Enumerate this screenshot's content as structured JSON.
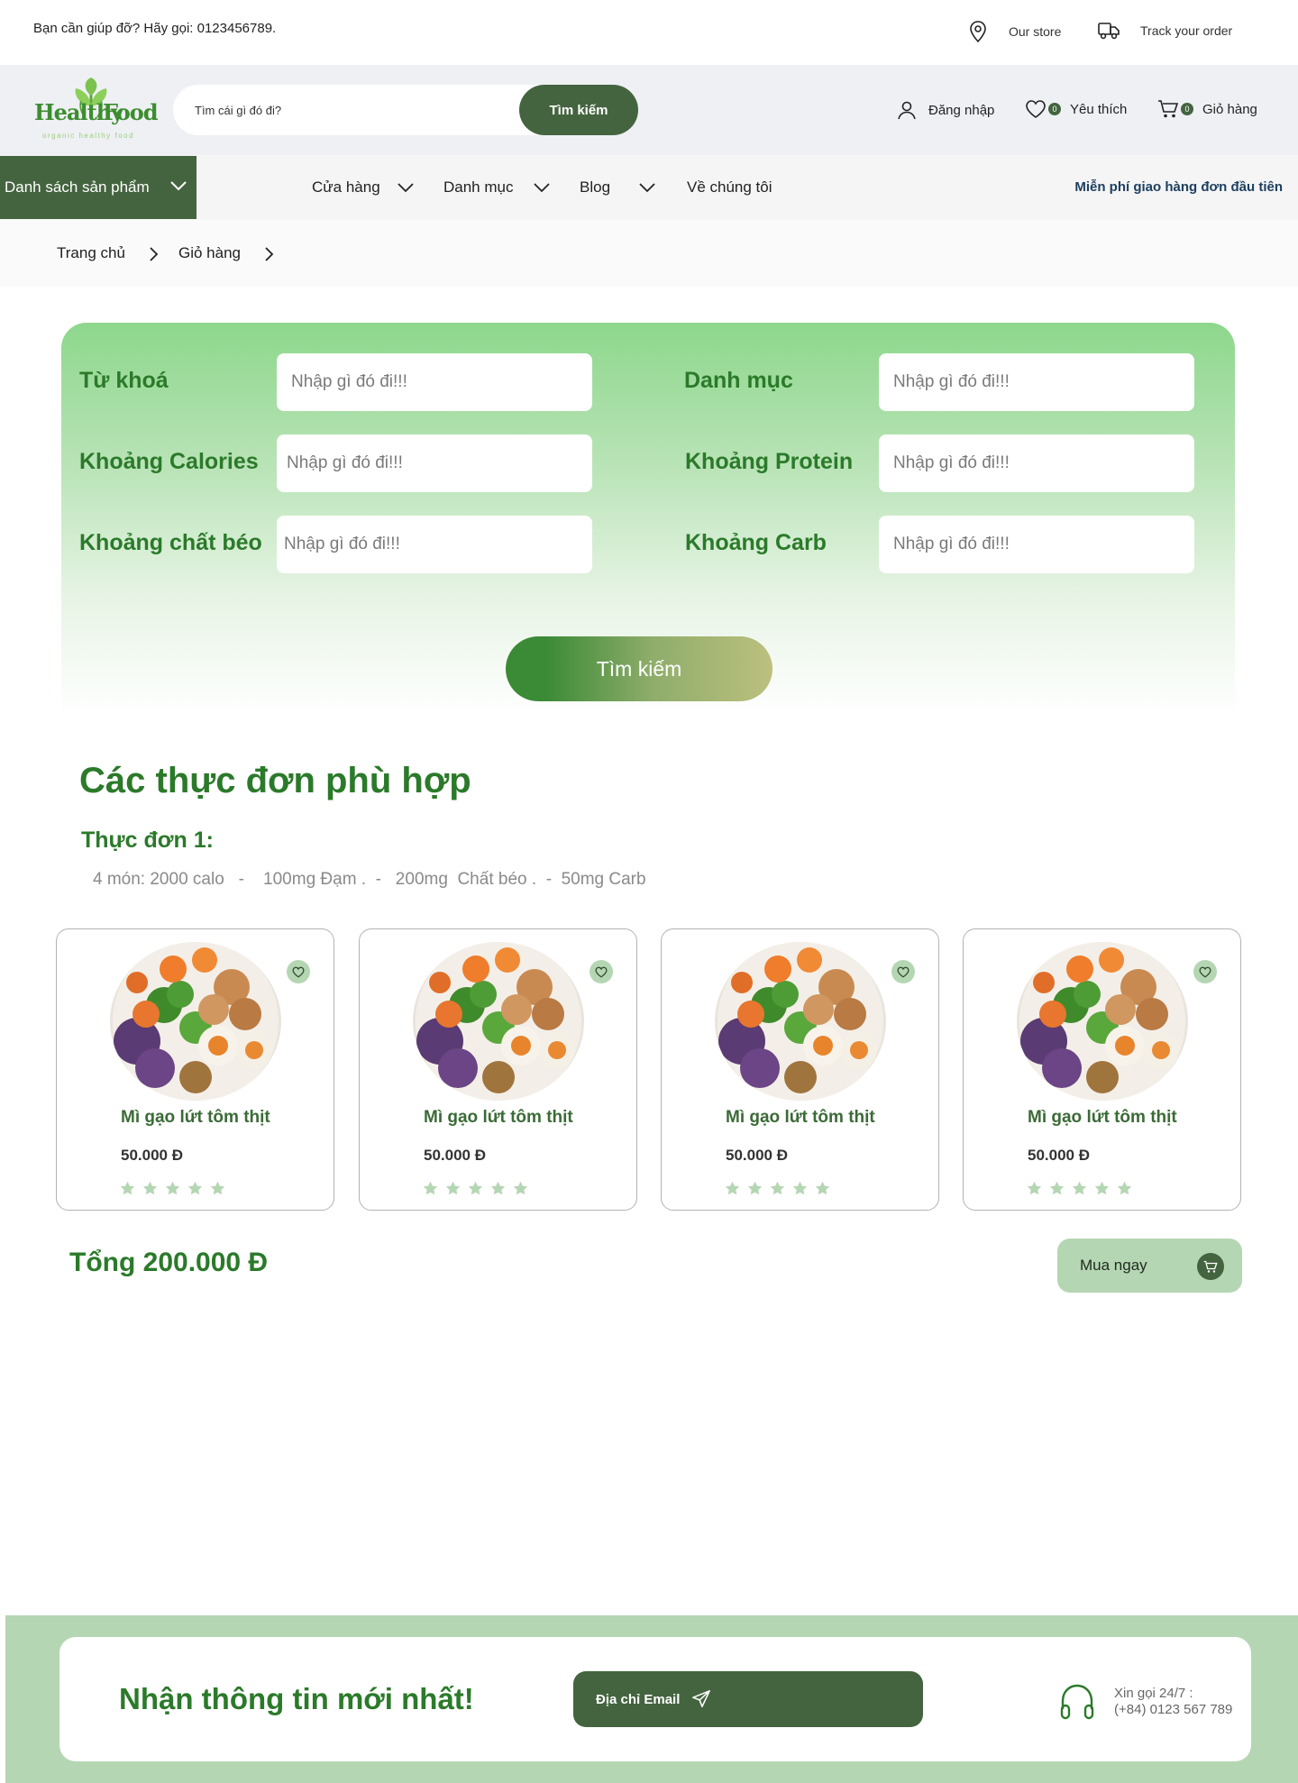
{
  "topbar": {
    "help": "Bạn cần giúp đỡ? Hãy gọi: 0123456789.",
    "store": "Our store",
    "track": "Track your order"
  },
  "header": {
    "logo_word1": "Healthy",
    "logo_word2": "Food",
    "logo_tagline": "organic healthy food",
    "search_placeholder": "Tìm cái gì đó đi?",
    "search_button": "Tìm kiếm",
    "login": "Đăng nhập",
    "wishlist": "Yêu thích",
    "wishlist_count": "0",
    "cart": "Giỏ hàng",
    "cart_count": "0"
  },
  "nav": {
    "categories_button": "Danh sách sản phẩm",
    "items": [
      "Cửa hàng",
      "Danh mục",
      "Blog",
      "Về chúng tôi"
    ],
    "free_shipping": "Miễn phí giao hàng đơn đầu tiên"
  },
  "breadcrumb": [
    "Trang chủ",
    "Giỏ hàng"
  ],
  "filter": {
    "keyword_label": "Từ khoá",
    "category_label": "Danh mục",
    "calories_label": "Khoảng Calories",
    "protein_label": "Khoảng Protein",
    "fat_label": "Khoảng chất béo",
    "carb_label": "Khoảng Carb",
    "placeholder": "Nhập gì đó đi!!!",
    "submit": "Tìm kiếm"
  },
  "results": {
    "title": "Các thực đơn phù hợp",
    "menu_title": "Thực đơn 1:",
    "menu_stats": "4 món: 2000 calo   -    100mg Đạm .  -   200mg  Chất béo .  -  50mg Carb",
    "products": [
      {
        "name": "Mì gạo lứt tôm thịt",
        "price": "50.000 Đ",
        "rating": 0
      },
      {
        "name": "Mì gạo lứt tôm thịt",
        "price": "50.000 Đ",
        "rating": 0
      },
      {
        "name": "Mì gạo lứt tôm thịt",
        "price": "50.000 Đ",
        "rating": 0
      },
      {
        "name": "Mì gạo lứt tôm thịt",
        "price": "50.000 Đ",
        "rating": 0
      }
    ],
    "total": "Tổng 200.000 Đ",
    "buy_button": "Mua ngay"
  },
  "footer": {
    "newsletter_title": "Nhận thông tin mới nhất!",
    "email_placeholder": "Địa chỉ Email",
    "hotline_label": "Xin gọi 24/7 :",
    "hotline_number": "(+84) 0123 567 789"
  },
  "colors": {
    "primary": "#44643f",
    "heading_green": "#2b7a2a",
    "soft_green": "#b5d6b3",
    "star": "#b5d6b3"
  }
}
